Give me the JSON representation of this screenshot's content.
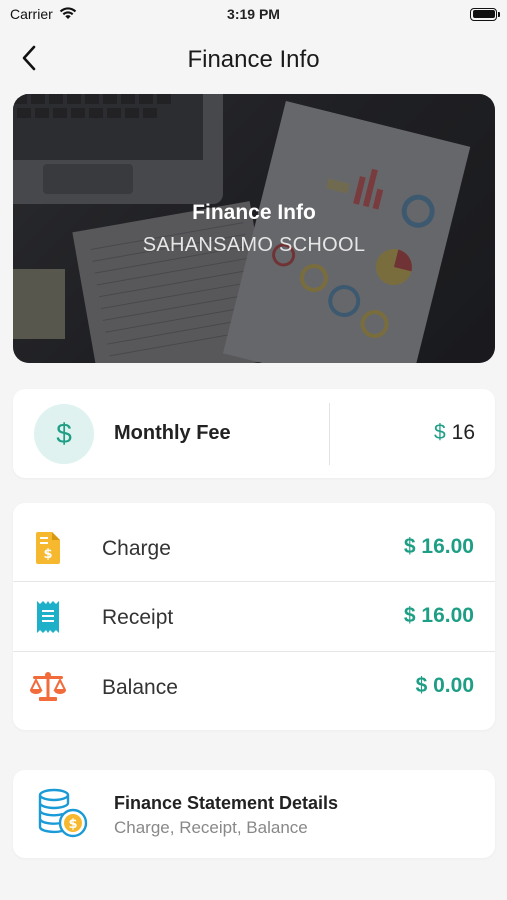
{
  "status_bar": {
    "carrier": "Carrier",
    "time": "3:19 PM"
  },
  "nav": {
    "title": "Finance Info"
  },
  "hero": {
    "title": "Finance Info",
    "subtitle": "SAHANSAMO SCHOOL"
  },
  "monthly_fee": {
    "icon_symbol": "$",
    "label": "Monthly Fee",
    "currency": "$",
    "amount": "16"
  },
  "summary": {
    "rows": [
      {
        "icon": "invoice-icon",
        "label": "Charge",
        "value": "$ 16.00",
        "icon_color": "#f5b82e"
      },
      {
        "icon": "receipt-icon",
        "label": "Receipt",
        "value": "$ 16.00",
        "icon_color": "#1fb0c9"
      },
      {
        "icon": "balance-scale-icon",
        "label": "Balance",
        "value": "$ 0.00",
        "icon_color": "#f26b3a"
      }
    ]
  },
  "statement": {
    "title": "Finance Statement Details",
    "subtitle": "Charge, Receipt, Balance"
  },
  "colors": {
    "accent": "#1f9e86",
    "background": "#f5f5f5"
  }
}
